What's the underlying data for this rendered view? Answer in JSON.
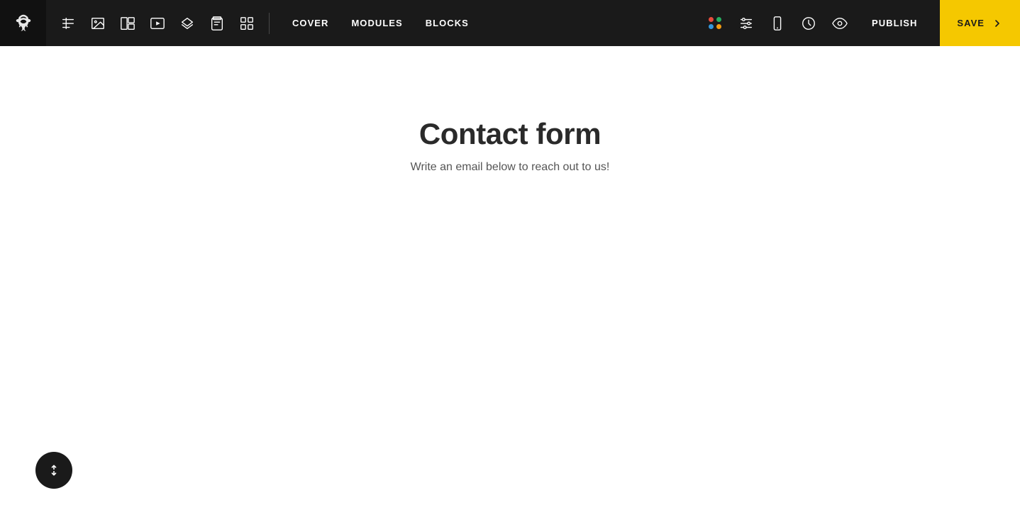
{
  "toolbar": {
    "logo_alt": "Brand Logo",
    "tools": [
      {
        "id": "text",
        "label": "Text Tool",
        "icon": "T"
      },
      {
        "id": "image",
        "label": "Image Tool",
        "icon": "img"
      },
      {
        "id": "gallery",
        "label": "Gallery Tool",
        "icon": "gallery"
      },
      {
        "id": "video",
        "label": "Video Tool",
        "icon": "video"
      },
      {
        "id": "layout",
        "label": "Layout Tool",
        "icon": "layout"
      },
      {
        "id": "form",
        "label": "Form Tool",
        "icon": "form"
      },
      {
        "id": "pattern",
        "label": "Pattern Tool",
        "icon": "pattern"
      }
    ],
    "nav": [
      {
        "id": "cover",
        "label": "COVER"
      },
      {
        "id": "modules",
        "label": "MODULES"
      },
      {
        "id": "blocks",
        "label": "BLOCKS"
      }
    ],
    "right_tools": [
      {
        "id": "colors",
        "label": "Color Palette"
      },
      {
        "id": "settings",
        "label": "Settings"
      },
      {
        "id": "mobile",
        "label": "Mobile Preview"
      },
      {
        "id": "history",
        "label": "History"
      },
      {
        "id": "preview",
        "label": "Preview"
      }
    ],
    "publish_label": "PUBLISH",
    "save_label": "SAVE"
  },
  "main": {
    "title": "Contact form",
    "subtitle": "Write an email below to reach out to us!"
  },
  "scroll_button": {
    "label": "Scroll up/down"
  },
  "colors": {
    "toolbar_bg": "#1a1a1a",
    "save_bg": "#f5c800",
    "accent": "#f5c800"
  }
}
